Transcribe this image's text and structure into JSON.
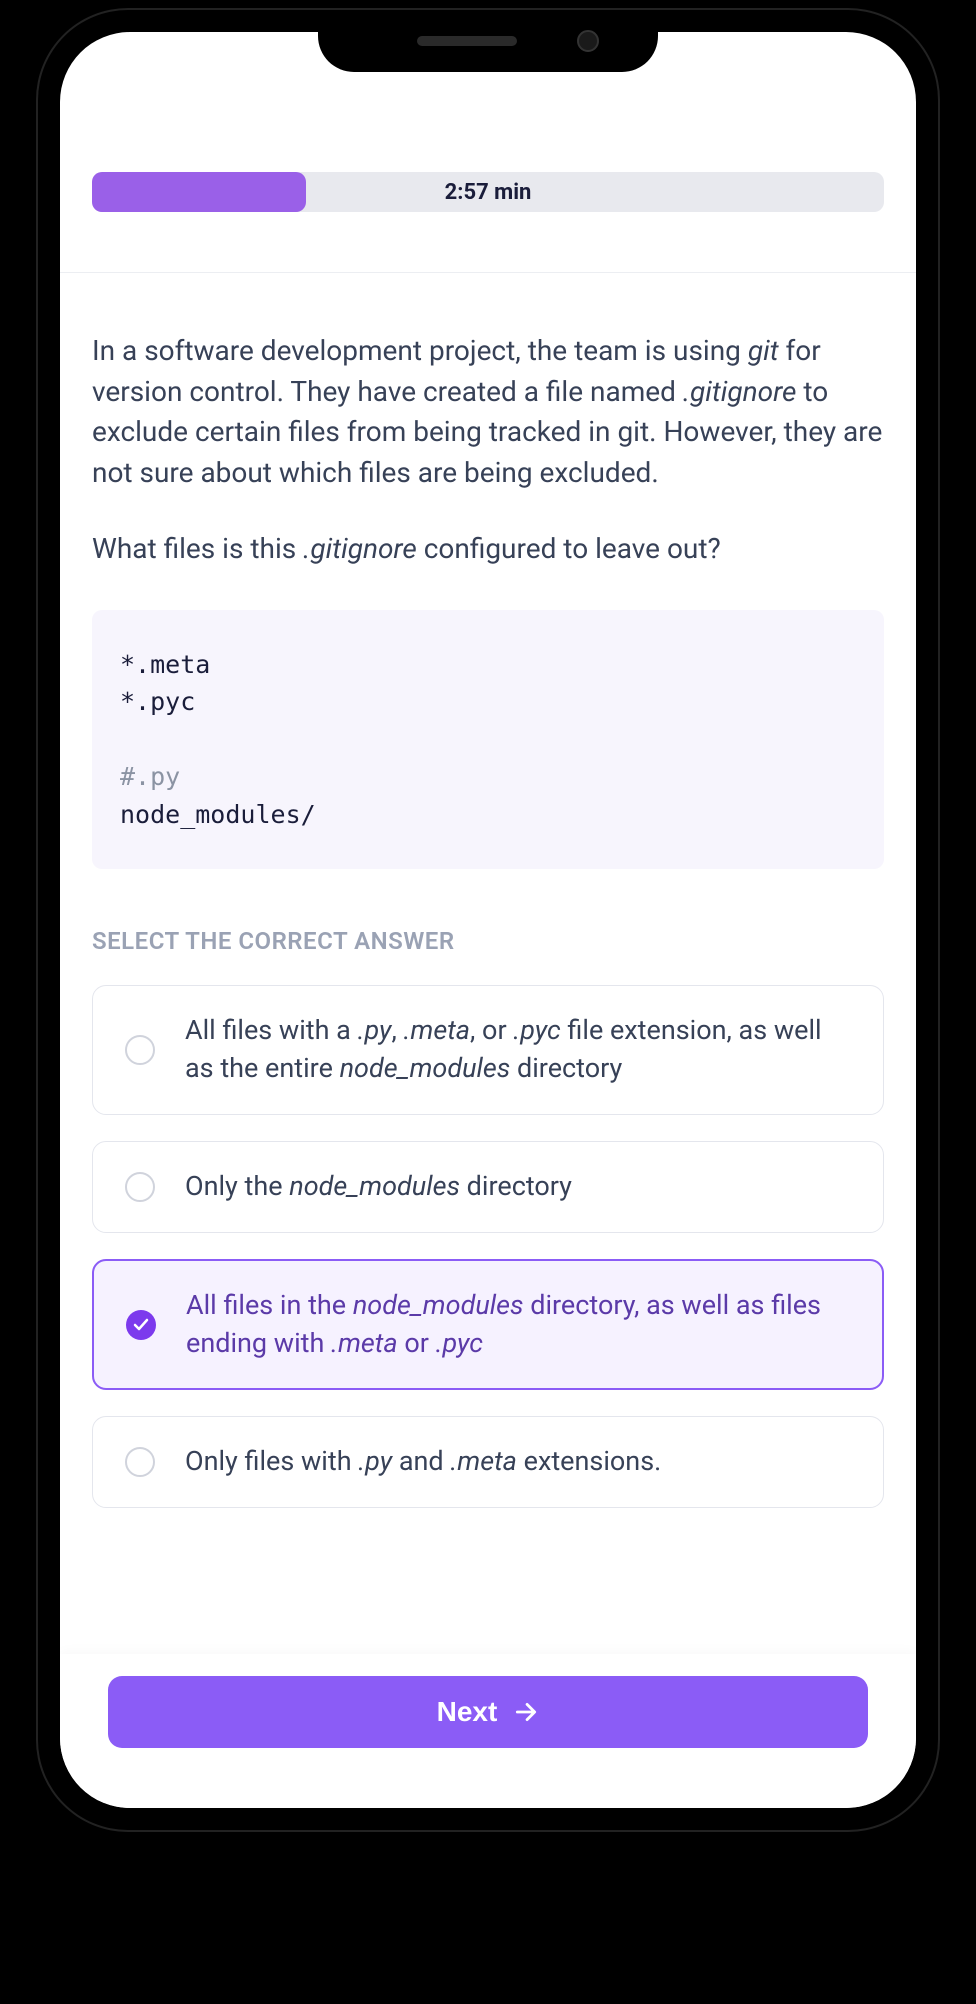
{
  "progress": {
    "percent": 27,
    "time_label": "2:57 min"
  },
  "question": {
    "para1_pre": "In a software development project, the team is using ",
    "para1_em1": "git",
    "para1_mid": " for version control. They have created a file named ",
    "para1_em2": ".gitignore",
    "para1_post": " to exclude certain files from being tracked in git. However, they are not sure about which files are being excluded.",
    "para2_pre": "What files is this ",
    "para2_em": ".gitignore",
    "para2_post": " configured to leave out?"
  },
  "code": {
    "line1": "*.meta",
    "line2": "*.pyc",
    "line3": "",
    "line4_comment": "#.py",
    "line5": "node_modules/"
  },
  "section_label": "SELECT THE CORRECT ANSWER",
  "answers": [
    {
      "selected": false,
      "t1": "All files with a ",
      "e1": ".py",
      "t2": ", ",
      "e2": ".meta",
      "t3": ", or ",
      "e3": ".pyc",
      "t4": " file extension, as well as the entire ",
      "e4": "node_modules",
      "t5": " directory"
    },
    {
      "selected": false,
      "t1": "Only the ",
      "e1": "node_modules",
      "t2": " directory"
    },
    {
      "selected": true,
      "t1": "All files in the ",
      "e1": "node_modules",
      "t2": " directory, as well as files ending with ",
      "e2": ".meta",
      "t3": " or ",
      "e3": ".pyc"
    },
    {
      "selected": false,
      "t1": "Only files with ",
      "e1": ".py",
      "t2": " and ",
      "e2": ".meta",
      "t3": " extensions."
    }
  ],
  "next_label": "Next"
}
